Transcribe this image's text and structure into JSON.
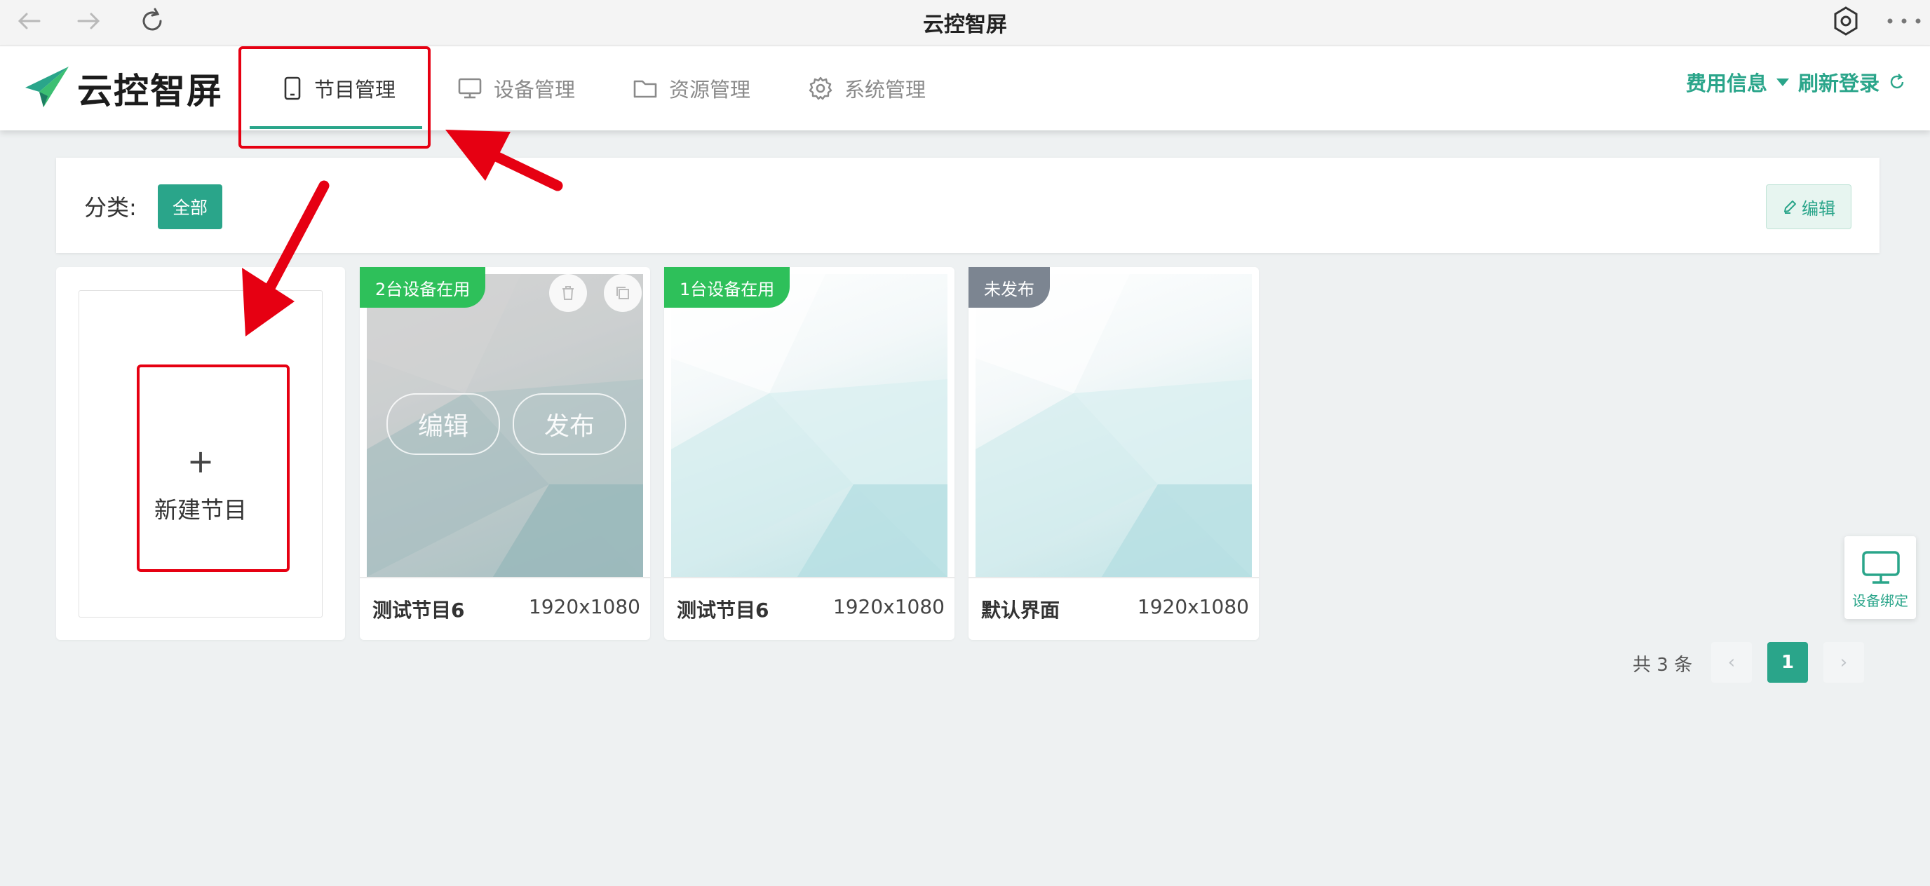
{
  "window": {
    "title": "云控智屏"
  },
  "header": {
    "logo_text": "云控智屏",
    "tabs": [
      {
        "label": "节目管理",
        "active": true,
        "icon": "tablet-icon"
      },
      {
        "label": "设备管理",
        "active": false,
        "icon": "monitor-icon"
      },
      {
        "label": "资源管理",
        "active": false,
        "icon": "folder-icon"
      },
      {
        "label": "系统管理",
        "active": false,
        "icon": "gear-icon"
      }
    ],
    "fee_info": "费用信息",
    "refresh_login": "刷新登录"
  },
  "filter": {
    "label": "分类:",
    "category_all": "全部",
    "edit": "编辑"
  },
  "new_program": {
    "plus": "+",
    "label": "新建节目"
  },
  "programs": [
    {
      "badge": "2台设备在用",
      "badge_color": "#2ec05a",
      "name": "测试节目6",
      "resolution": "1920x1080",
      "hover_edit": "编辑",
      "hover_publish": "发布"
    },
    {
      "badge": "1台设备在用",
      "badge_color": "#2ec05a",
      "name": "测试节目6",
      "resolution": "1920x1080"
    },
    {
      "badge": "未发布",
      "badge_color": "#7c8591",
      "name": "默认界面",
      "resolution": "1920x1080"
    }
  ],
  "pagination": {
    "total": "共 3 条",
    "current": "1",
    "prev": "‹",
    "next": "›"
  },
  "float_bind": {
    "label": "设备绑定"
  },
  "colors": {
    "accent": "#2aa58a",
    "annotation": "#e60012"
  }
}
